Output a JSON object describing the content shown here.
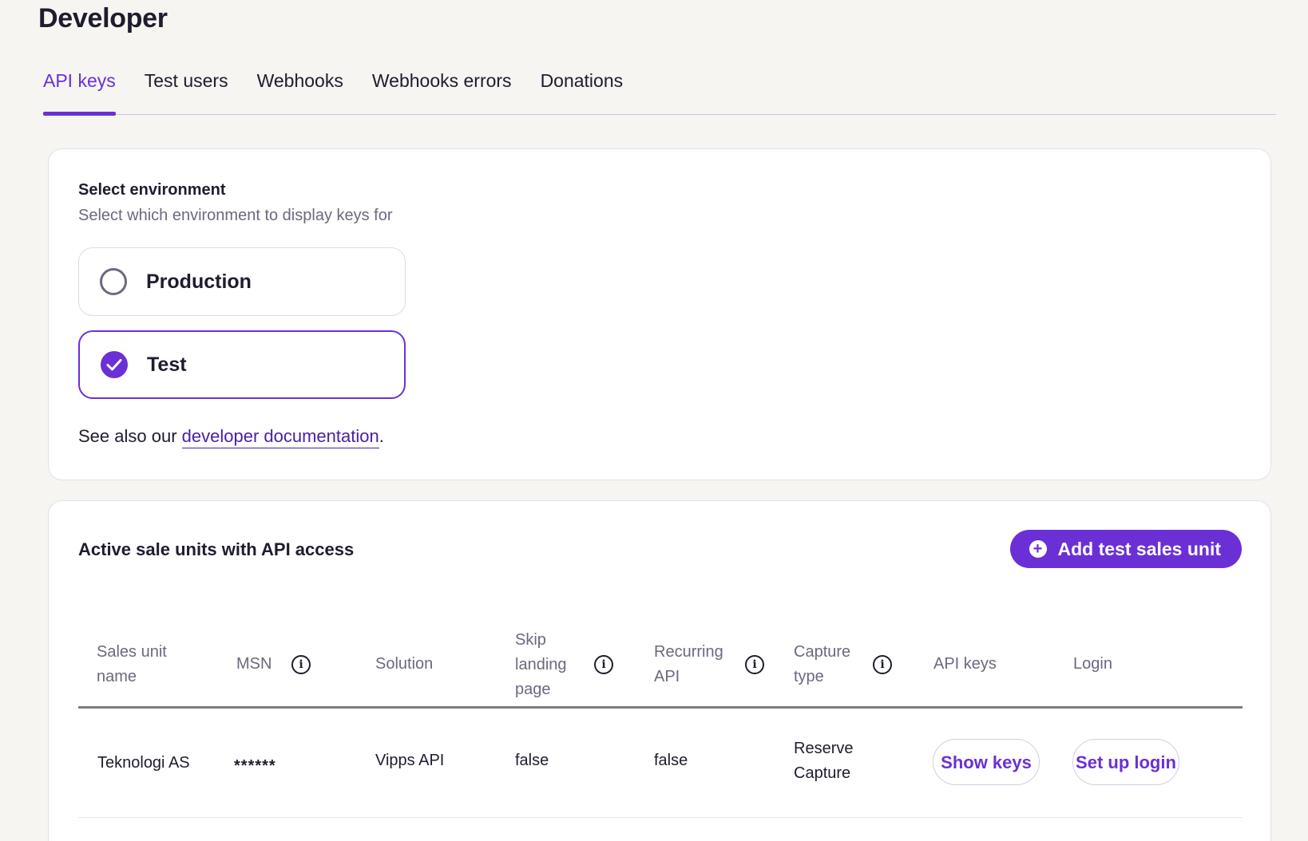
{
  "page": {
    "title": "Developer"
  },
  "tabs": [
    {
      "label": "API keys",
      "active": true
    },
    {
      "label": "Test users"
    },
    {
      "label": "Webhooks"
    },
    {
      "label": "Webhooks errors"
    },
    {
      "label": "Donations"
    }
  ],
  "environment": {
    "title": "Select environment",
    "subtitle": "Select which environment to display keys for",
    "options": [
      {
        "label": "Production",
        "selected": false
      },
      {
        "label": "Test",
        "selected": true
      }
    ],
    "see_also_prefix": "See also our ",
    "doc_link": "developer documentation",
    "see_also_suffix": "."
  },
  "units": {
    "title": "Active sale units with API access",
    "add_button": "Add test sales unit",
    "columns": [
      "Sales unit name",
      "MSN",
      "Solution",
      "Skip landing page",
      "Recurring API",
      "Capture type",
      "API keys",
      "Login"
    ],
    "rows": [
      {
        "name": "Teknologi AS",
        "msn": "******",
        "solution": "Vipps API",
        "skip_landing": "false",
        "recurring": "false",
        "capture": "Reserve Capture",
        "api_keys_button": "Show keys",
        "login_button": "Set up login"
      }
    ]
  },
  "colors": {
    "accent": "#6b2fd6",
    "background": "#f6f5f2",
    "muted": "#6c6880"
  }
}
